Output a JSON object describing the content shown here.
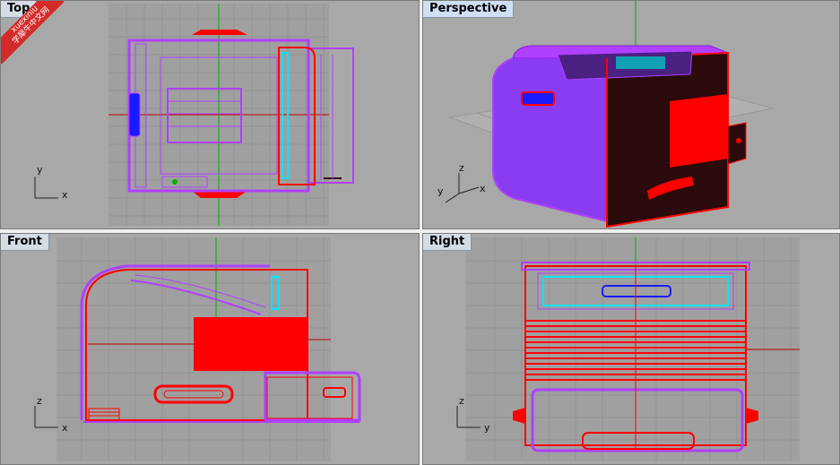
{
  "watermark": {
    "line1": "xuexiniu",
    "line2": "学犀牛中文网"
  },
  "viewports": [
    {
      "id": "top",
      "title": "Top",
      "axes": [
        "y",
        "x"
      ]
    },
    {
      "id": "perspective",
      "title": "Perspective",
      "axes": [
        "z",
        "y",
        "x"
      ]
    },
    {
      "id": "front",
      "title": "Front",
      "axes": [
        "z",
        "x"
      ]
    },
    {
      "id": "right",
      "title": "Right",
      "axes": [
        "z",
        "y"
      ]
    }
  ],
  "colors": {
    "viewport_bg": "#a8a8a8",
    "grid": "#9b9b9b",
    "grid_major": "#8c8c8c",
    "wire_red": "#ff0000",
    "wire_magenta": "#b040ff",
    "wire_cyan": "#00e5ff",
    "wire_blue": "#1a1aff",
    "axis_green": "#00b000",
    "title_bg": "#d4dce6",
    "dark_fill": "#2a0a0a"
  }
}
